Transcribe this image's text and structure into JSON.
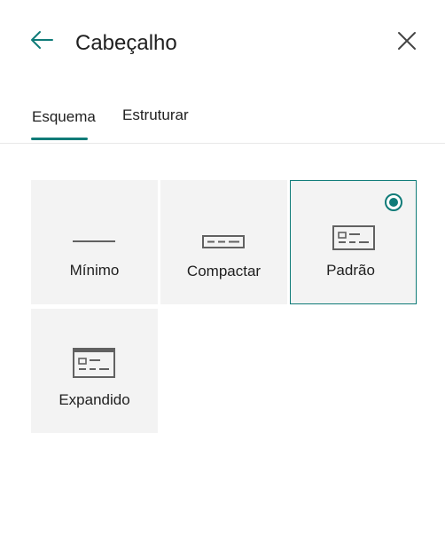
{
  "header": {
    "title": "Cabeçalho",
    "back_icon": "arrow-left-icon",
    "close_icon": "close-icon"
  },
  "tabs": [
    {
      "label": "Esquema",
      "selected": true
    },
    {
      "label": "Estruturar",
      "selected": false
    }
  ],
  "layouts": [
    {
      "label": "Mínimo",
      "icon": "minimal-layout-icon",
      "selected": false
    },
    {
      "label": "Compactar",
      "icon": "compact-layout-icon",
      "selected": false
    },
    {
      "label": "Padrão",
      "icon": "standard-layout-icon",
      "selected": true
    },
    {
      "label": "Expandido",
      "icon": "expanded-layout-icon",
      "selected": false
    }
  ],
  "colors": {
    "accent": "#0f7b78",
    "card_background": "#f3f3f3",
    "icon_gray": "#616161",
    "text": "#1f1f1f"
  }
}
